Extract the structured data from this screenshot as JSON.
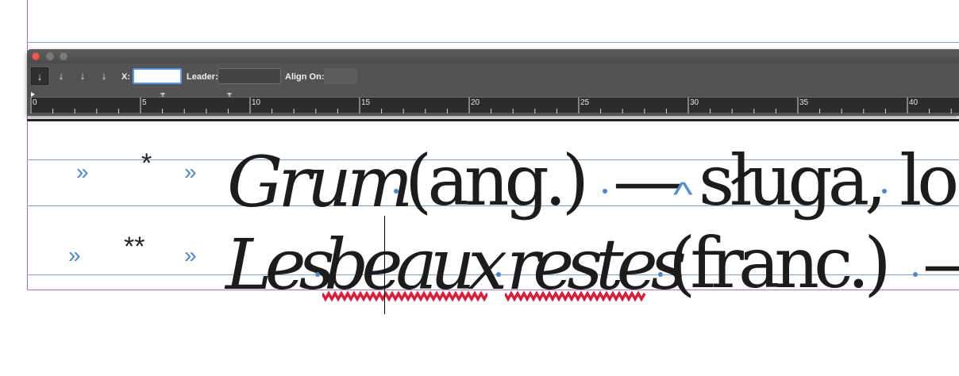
{
  "panel": {
    "window_controls": [
      "close-button",
      "minimize-button",
      "zoom-button"
    ],
    "tab_buttons": [
      {
        "name": "left-justified-tab-button",
        "glyph": "↓",
        "active": true
      },
      {
        "name": "center-justified-tab-button",
        "glyph": "↓",
        "active": false
      },
      {
        "name": "right-justified-tab-button",
        "glyph": "↓",
        "active": false
      },
      {
        "name": "align-to-decimal-tab-button",
        "glyph": "↓",
        "active": false
      }
    ],
    "x_label": "X:",
    "x_value": "",
    "leader_label": "Leader:",
    "leader_value": "",
    "align_on_label": "Align On:",
    "align_on_value": "",
    "ruler_numbers": [
      "0",
      "5",
      "10",
      "15",
      "20",
      "25",
      "30",
      "35",
      "40"
    ]
  },
  "document": {
    "line1": {
      "marker_left": "»",
      "star": "*",
      "marker_right": "»",
      "word1": "Grum",
      "word2": "(ang.)",
      "dash": "—",
      "rest": "sługa, lo"
    },
    "line2": {
      "marker_left": "»",
      "star": "**",
      "marker_right": "»",
      "word1": "Les",
      "word2": "beaux",
      "word3": "restes",
      "word4": "(franc.)",
      "dash": "—"
    }
  },
  "colors": {
    "panel_bg": "#535353",
    "guide_blue": "#7d9fd0",
    "margin_purple": "#c070c8",
    "invisible_chars": "#4f87c4",
    "spellcheck_red": "#d0203a",
    "close_red": "#ee5c55",
    "focus_blue": "#5f9be8"
  }
}
